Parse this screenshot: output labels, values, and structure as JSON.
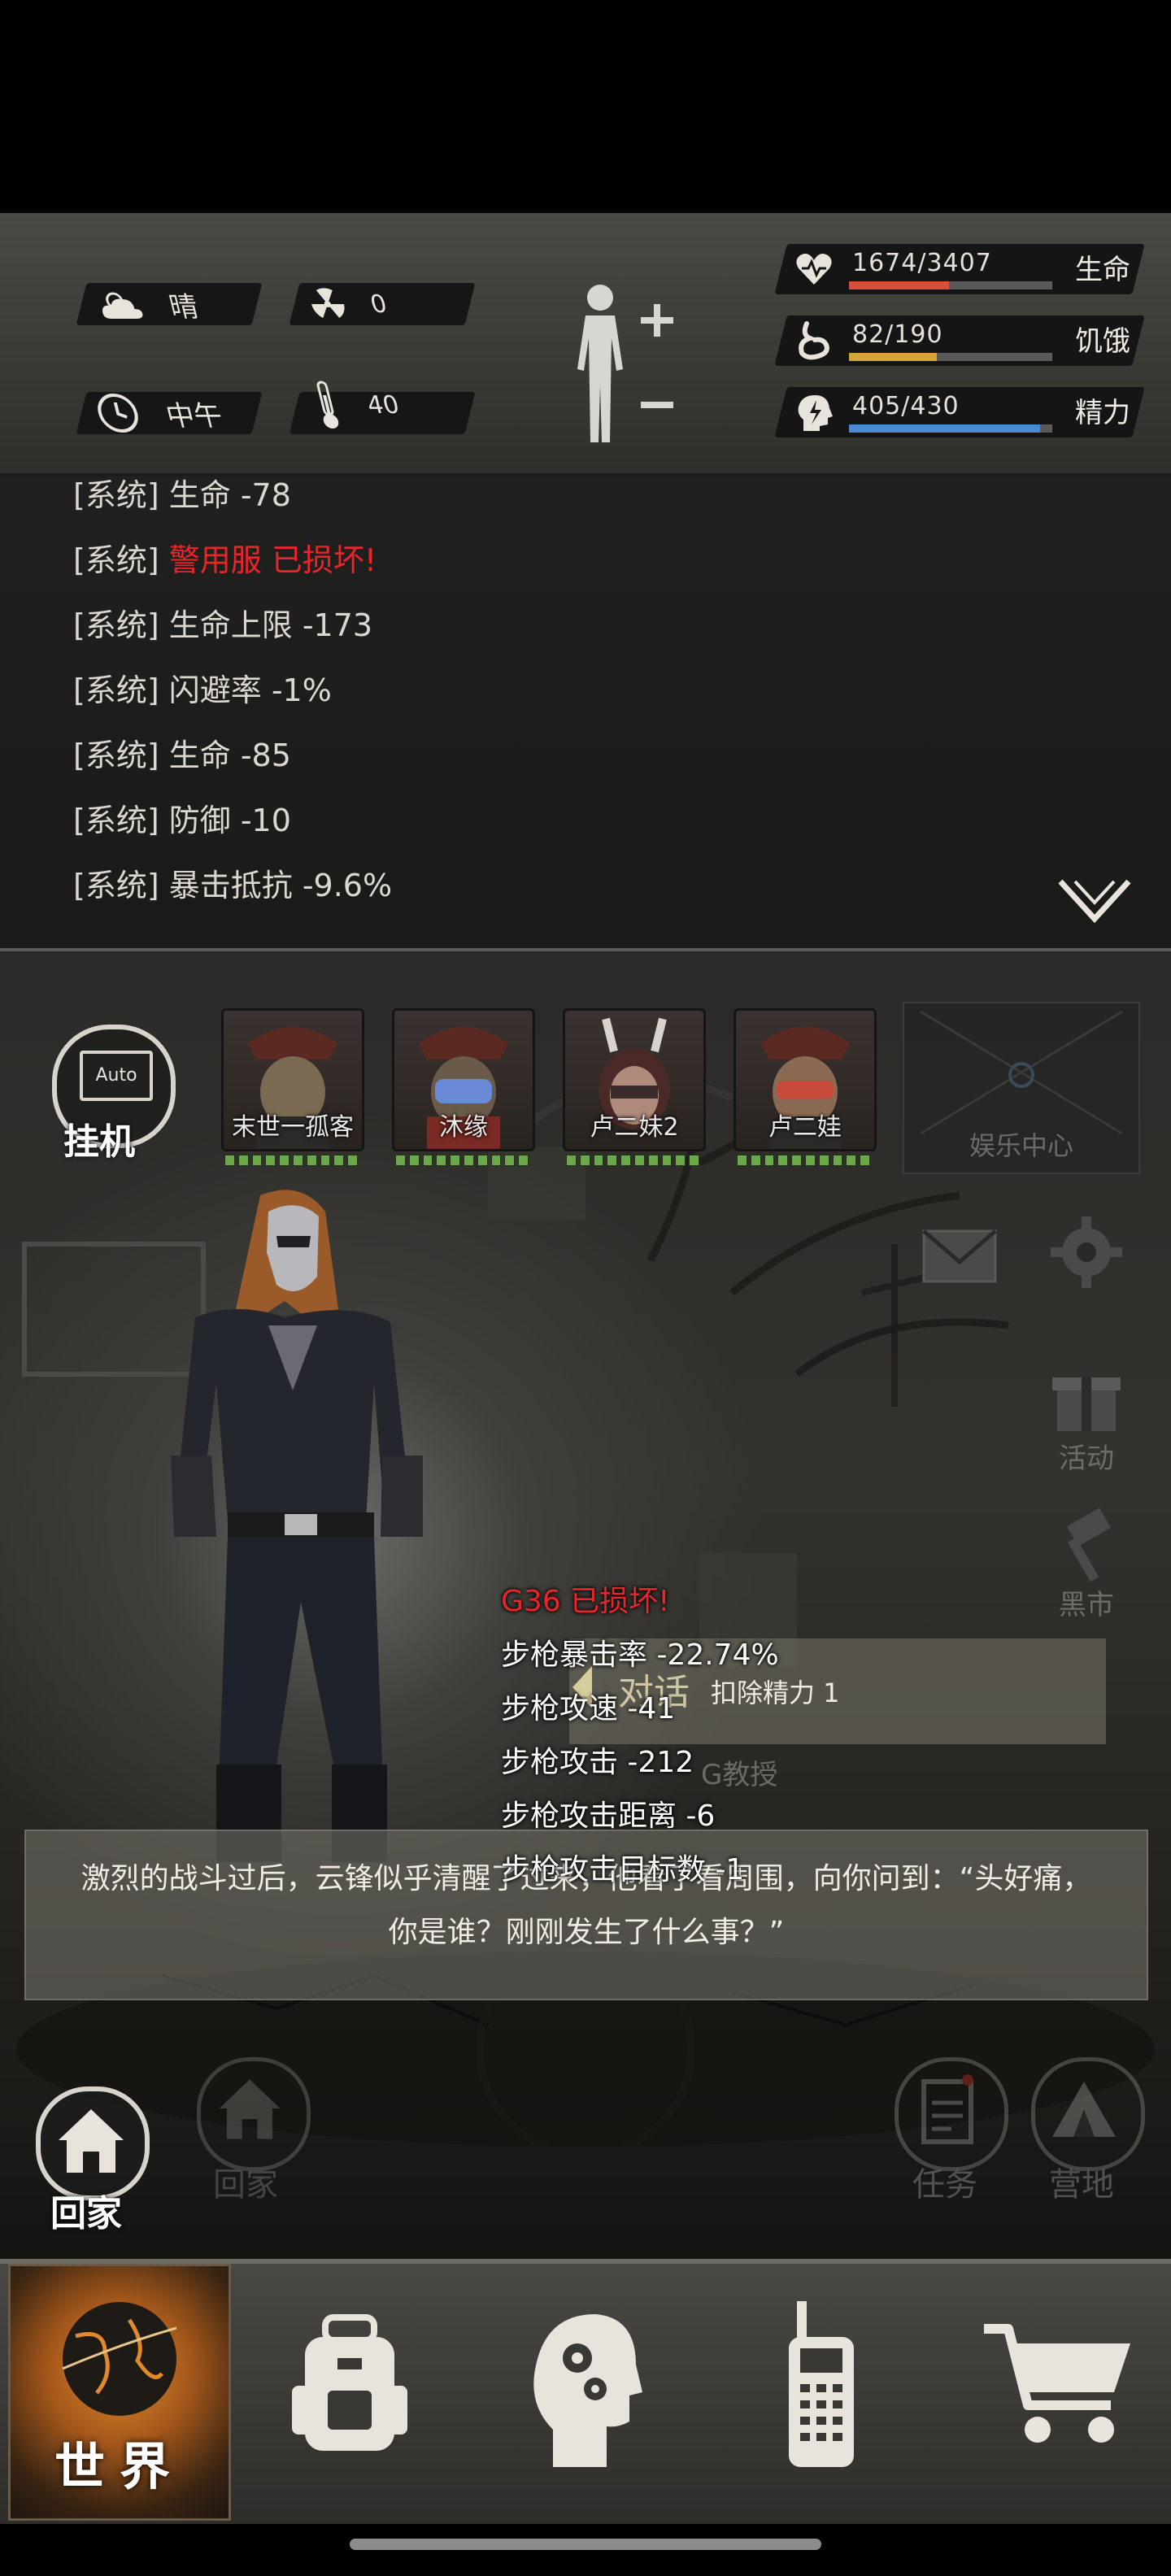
{
  "status": {
    "weather": {
      "icon": "cloud-sun-icon",
      "label": "晴"
    },
    "radiation": {
      "icon": "radiation-icon",
      "value": "0"
    },
    "time": {
      "icon": "clock-icon",
      "label": "中午"
    },
    "temperature": {
      "icon": "thermometer-icon",
      "value": "40"
    },
    "body_icon": "body-status-icon",
    "stats": [
      {
        "icon": "heart-icon",
        "value": "1674/3407",
        "label": "生命",
        "fraction": 0.49,
        "color": "#d8503a"
      },
      {
        "icon": "stomach-icon",
        "value": "82/190",
        "label": "饥饿",
        "fraction": 0.43,
        "color": "#d6a23a"
      },
      {
        "icon": "energy-head-icon",
        "value": "405/430",
        "label": "精力",
        "fraction": 0.94,
        "color": "#4a8ad0"
      }
    ]
  },
  "log": {
    "lines": [
      {
        "prefix": "[系统]",
        "text": "生命 -78",
        "highlight": false
      },
      {
        "prefix": "[系统]",
        "text": "警用服 已损坏!",
        "highlight": true
      },
      {
        "prefix": "[系统]",
        "text": "生命上限 -173",
        "highlight": false
      },
      {
        "prefix": "[系统]",
        "text": "闪避率 -1%",
        "highlight": false
      },
      {
        "prefix": "[系统]",
        "text": "生命 -85",
        "highlight": false
      },
      {
        "prefix": "[系统]",
        "text": "防御 -10",
        "highlight": false
      },
      {
        "prefix": "[系统]",
        "text": "暴击抵抗 -9.6%",
        "highlight": false
      }
    ],
    "collapse_icon": "chevron-down-icon"
  },
  "scene": {
    "auto_button": {
      "badge": "Auto",
      "label": "挂机"
    },
    "team": [
      {
        "name": "末世一孤客"
      },
      {
        "name": "沐缘"
      },
      {
        "name": "卢二妹2"
      },
      {
        "name": "卢二娃"
      }
    ],
    "entertainment_label": "娱乐中心",
    "side_buttons": {
      "mail": "mail-icon",
      "settings": "gear-icon",
      "activity": "活动",
      "black_market": "黑市"
    },
    "damage_popup": {
      "title": "G36 已损坏!",
      "lines": [
        "步枪暴击率 -22.74%",
        "步枪攻速 -41",
        "步枪攻击 -212",
        "步枪攻击距离 -6",
        "步枪攻击目标数 -1"
      ]
    },
    "talk_button": {
      "label": "对话",
      "note": "扣除精力 1"
    },
    "npc_tag": "G教授",
    "dialogue": "激烈的战斗过后，云锋似乎清醒了过来，他看了看周围，向你问到：“头好痛，你是谁？刚刚发生了什么事？”",
    "bottom_buttons": {
      "home_active": "回家",
      "home_ghost": "回家",
      "task": "任务",
      "camp": "营地"
    }
  },
  "nav": {
    "tabs": [
      {
        "name": "world",
        "label": "世界",
        "icon": "globe-icon",
        "active": true
      },
      {
        "name": "backpack",
        "label": "",
        "icon": "backpack-icon",
        "active": false
      },
      {
        "name": "skills",
        "label": "",
        "icon": "head-gears-icon",
        "active": false
      },
      {
        "name": "radio",
        "label": "",
        "icon": "walkie-talkie-icon",
        "active": false
      },
      {
        "name": "shop",
        "label": "",
        "icon": "shopping-cart-icon",
        "active": false
      }
    ]
  }
}
